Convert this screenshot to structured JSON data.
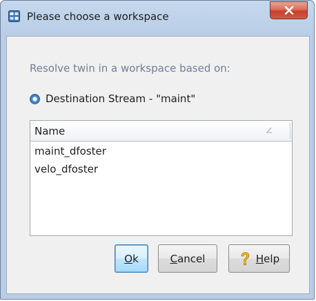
{
  "window": {
    "title": "Please choose a workspace",
    "app_icon": "workspace-icon",
    "close_icon": "close-icon"
  },
  "prompt": "Resolve twin in a workspace based on:",
  "option": {
    "label": "Destination Stream - \"maint\"",
    "selected": true
  },
  "table": {
    "column": "Name",
    "sort_icon": "sort-indicator-icon",
    "rows": [
      "maint_dfoster",
      "velo_dfoster"
    ]
  },
  "buttons": {
    "ok": {
      "mnemonic": "O",
      "rest": "k"
    },
    "cancel": {
      "mnemonic": "C",
      "rest": "ancel"
    },
    "help": {
      "mnemonic": "H",
      "rest": "elp",
      "icon": "help-icon"
    }
  },
  "colors": {
    "prompt_text": "#6f7f95",
    "default_button": "#bee6fd",
    "close_button": "#c7402d"
  }
}
